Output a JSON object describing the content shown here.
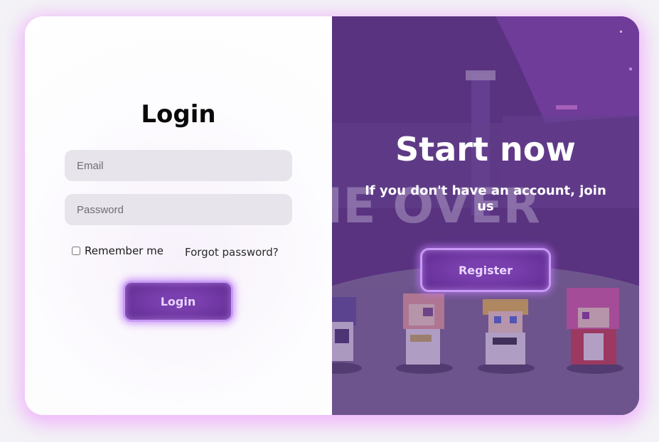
{
  "login": {
    "title": "Login",
    "email_placeholder": "Email",
    "password_placeholder": "Password",
    "remember_label": "Remember me",
    "remember_checked": false,
    "forgot_label": "Forgot password?",
    "login_button": "Login"
  },
  "signup": {
    "title": "Start now",
    "subtitle": "If you don't have an account, join us",
    "register_button": "Register"
  },
  "background": {
    "banner_text": "IE OVER"
  },
  "colors": {
    "accent": "#7a3fae",
    "glow": "#ec82ff",
    "field_bg": "#e7e5eb"
  }
}
